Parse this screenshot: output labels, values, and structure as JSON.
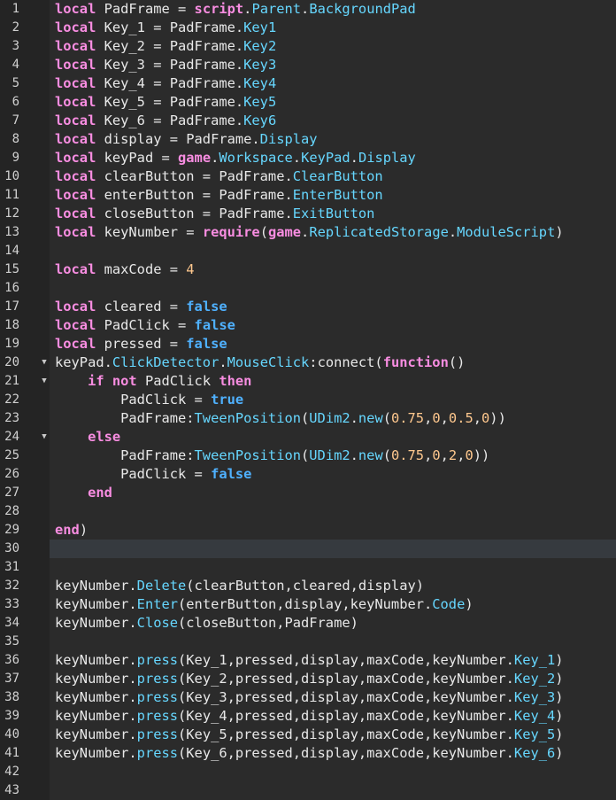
{
  "editor": {
    "current_line": 30,
    "fold_markers": [
      20,
      21,
      24
    ],
    "fold_icon": "triangle-down-icon",
    "colors": {
      "background": "#2b2b2b",
      "gutter": "#242424",
      "current_line": "#363a3f",
      "keyword": "#f88de1",
      "identifier": "#e8e8e8",
      "property": "#66d7ff",
      "boolean": "#4fb1ff",
      "number": "#ffc88e"
    },
    "lines": [
      [
        [
          "kw",
          "local"
        ],
        [
          "id",
          " PadFrame = "
        ],
        [
          "kw",
          "script"
        ],
        [
          "id",
          "."
        ],
        [
          "prop",
          "Parent"
        ],
        [
          "id",
          "."
        ],
        [
          "prop",
          "BackgroundPad"
        ]
      ],
      [
        [
          "kw",
          "local"
        ],
        [
          "id",
          " Key_1 = PadFrame."
        ],
        [
          "prop",
          "Key1"
        ]
      ],
      [
        [
          "kw",
          "local"
        ],
        [
          "id",
          " Key_2 = PadFrame."
        ],
        [
          "prop",
          "Key2"
        ]
      ],
      [
        [
          "kw",
          "local"
        ],
        [
          "id",
          " Key_3 = PadFrame."
        ],
        [
          "prop",
          "Key3"
        ]
      ],
      [
        [
          "kw",
          "local"
        ],
        [
          "id",
          " Key_4 = PadFrame."
        ],
        [
          "prop",
          "Key4"
        ]
      ],
      [
        [
          "kw",
          "local"
        ],
        [
          "id",
          " Key_5 = PadFrame."
        ],
        [
          "prop",
          "Key5"
        ]
      ],
      [
        [
          "kw",
          "local"
        ],
        [
          "id",
          " Key_6 = PadFrame."
        ],
        [
          "prop",
          "Key6"
        ]
      ],
      [
        [
          "kw",
          "local"
        ],
        [
          "id",
          " display = PadFrame."
        ],
        [
          "prop",
          "Display"
        ]
      ],
      [
        [
          "kw",
          "local"
        ],
        [
          "id",
          " keyPad = "
        ],
        [
          "kw",
          "game"
        ],
        [
          "id",
          "."
        ],
        [
          "prop",
          "Workspace"
        ],
        [
          "id",
          "."
        ],
        [
          "prop",
          "KeyPad"
        ],
        [
          "id",
          "."
        ],
        [
          "prop",
          "Display"
        ]
      ],
      [
        [
          "kw",
          "local"
        ],
        [
          "id",
          " clearButton = PadFrame."
        ],
        [
          "prop",
          "ClearButton"
        ]
      ],
      [
        [
          "kw",
          "local"
        ],
        [
          "id",
          " enterButton = PadFrame."
        ],
        [
          "prop",
          "EnterButton"
        ]
      ],
      [
        [
          "kw",
          "local"
        ],
        [
          "id",
          " closeButton = PadFrame."
        ],
        [
          "prop",
          "ExitButton"
        ]
      ],
      [
        [
          "kw",
          "local"
        ],
        [
          "id",
          " keyNumber = "
        ],
        [
          "kw",
          "require"
        ],
        [
          "id",
          "("
        ],
        [
          "kw",
          "game"
        ],
        [
          "id",
          "."
        ],
        [
          "prop",
          "ReplicatedStorage"
        ],
        [
          "id",
          "."
        ],
        [
          "prop",
          "ModuleScript"
        ],
        [
          "id",
          ")"
        ]
      ],
      [],
      [
        [
          "kw",
          "local"
        ],
        [
          "id",
          " maxCode = "
        ],
        [
          "num",
          "4"
        ]
      ],
      [],
      [
        [
          "kw",
          "local"
        ],
        [
          "id",
          " cleared = "
        ],
        [
          "bool",
          "false"
        ]
      ],
      [
        [
          "kw",
          "local"
        ],
        [
          "id",
          " PadClick = "
        ],
        [
          "bool",
          "false"
        ]
      ],
      [
        [
          "kw",
          "local"
        ],
        [
          "id",
          " pressed = "
        ],
        [
          "bool",
          "false"
        ]
      ],
      [
        [
          "id",
          "keyPad."
        ],
        [
          "prop",
          "ClickDetector"
        ],
        [
          "id",
          "."
        ],
        [
          "prop",
          "MouseClick"
        ],
        [
          "id",
          ":connect("
        ],
        [
          "kw",
          "function"
        ],
        [
          "id",
          "()"
        ]
      ],
      [
        [
          "id",
          "    "
        ],
        [
          "kw",
          "if not"
        ],
        [
          "id",
          " PadClick "
        ],
        [
          "kw",
          "then"
        ]
      ],
      [
        [
          "id",
          "        PadClick = "
        ],
        [
          "bool",
          "true"
        ]
      ],
      [
        [
          "id",
          "        PadFrame:"
        ],
        [
          "prop",
          "TweenPosition"
        ],
        [
          "id",
          "("
        ],
        [
          "prop",
          "UDim2"
        ],
        [
          "id",
          "."
        ],
        [
          "prop",
          "new"
        ],
        [
          "id",
          "("
        ],
        [
          "num",
          "0.75"
        ],
        [
          "id",
          ","
        ],
        [
          "num",
          "0"
        ],
        [
          "id",
          ","
        ],
        [
          "num",
          "0.5"
        ],
        [
          "id",
          ","
        ],
        [
          "num",
          "0"
        ],
        [
          "id",
          "))"
        ]
      ],
      [
        [
          "id",
          "    "
        ],
        [
          "kw",
          "else"
        ]
      ],
      [
        [
          "id",
          "        PadFrame:"
        ],
        [
          "prop",
          "TweenPosition"
        ],
        [
          "id",
          "("
        ],
        [
          "prop",
          "UDim2"
        ],
        [
          "id",
          "."
        ],
        [
          "prop",
          "new"
        ],
        [
          "id",
          "("
        ],
        [
          "num",
          "0.75"
        ],
        [
          "id",
          ","
        ],
        [
          "num",
          "0"
        ],
        [
          "id",
          ","
        ],
        [
          "num",
          "2"
        ],
        [
          "id",
          ","
        ],
        [
          "num",
          "0"
        ],
        [
          "id",
          "))"
        ]
      ],
      [
        [
          "id",
          "        PadClick = "
        ],
        [
          "bool",
          "false"
        ]
      ],
      [
        [
          "id",
          "    "
        ],
        [
          "kw",
          "end"
        ]
      ],
      [],
      [
        [
          "kw",
          "end"
        ],
        [
          "id",
          ")"
        ]
      ],
      [],
      [],
      [
        [
          "id",
          "keyNumber."
        ],
        [
          "prop",
          "Delete"
        ],
        [
          "id",
          "(clearButton,cleared,display)"
        ]
      ],
      [
        [
          "id",
          "keyNumber."
        ],
        [
          "prop",
          "Enter"
        ],
        [
          "id",
          "(enterButton,display,keyNumber."
        ],
        [
          "prop",
          "Code"
        ],
        [
          "id",
          ")"
        ]
      ],
      [
        [
          "id",
          "keyNumber."
        ],
        [
          "prop",
          "Close"
        ],
        [
          "id",
          "(closeButton,PadFrame)"
        ]
      ],
      [],
      [
        [
          "id",
          "keyNumber."
        ],
        [
          "prop",
          "press"
        ],
        [
          "id",
          "(Key_1,pressed,display,maxCode,keyNumber."
        ],
        [
          "prop",
          "Key_1"
        ],
        [
          "id",
          ")"
        ]
      ],
      [
        [
          "id",
          "keyNumber."
        ],
        [
          "prop",
          "press"
        ],
        [
          "id",
          "(Key_2,pressed,display,maxCode,keyNumber."
        ],
        [
          "prop",
          "Key_2"
        ],
        [
          "id",
          ")"
        ]
      ],
      [
        [
          "id",
          "keyNumber."
        ],
        [
          "prop",
          "press"
        ],
        [
          "id",
          "(Key_3,pressed,display,maxCode,keyNumber."
        ],
        [
          "prop",
          "Key_3"
        ],
        [
          "id",
          ")"
        ]
      ],
      [
        [
          "id",
          "keyNumber."
        ],
        [
          "prop",
          "press"
        ],
        [
          "id",
          "(Key_4,pressed,display,maxCode,keyNumber."
        ],
        [
          "prop",
          "Key_4"
        ],
        [
          "id",
          ")"
        ]
      ],
      [
        [
          "id",
          "keyNumber."
        ],
        [
          "prop",
          "press"
        ],
        [
          "id",
          "(Key_5,pressed,display,maxCode,keyNumber."
        ],
        [
          "prop",
          "Key_5"
        ],
        [
          "id",
          ")"
        ]
      ],
      [
        [
          "id",
          "keyNumber."
        ],
        [
          "prop",
          "press"
        ],
        [
          "id",
          "(Key_6,pressed,display,maxCode,keyNumber."
        ],
        [
          "prop",
          "Key_6"
        ],
        [
          "id",
          ")"
        ]
      ],
      [],
      []
    ]
  }
}
